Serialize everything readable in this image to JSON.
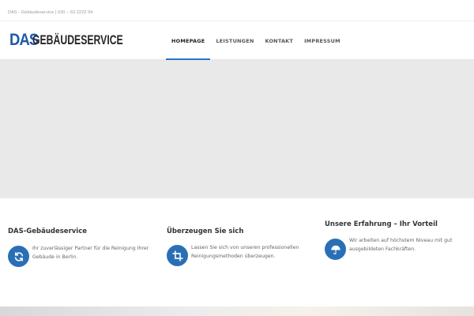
{
  "topbar": {
    "text": "DAS - Gebäudeservice | 030 – 63 2222 94"
  },
  "header": {
    "logo": {
      "part1": "DAS",
      "part2": "GEBÄUDESERVICE"
    },
    "nav": [
      {
        "label": "HOMEPAGE",
        "active": true
      },
      {
        "label": "LEISTUNGEN",
        "active": false
      },
      {
        "label": "KONTAKT",
        "active": false
      },
      {
        "label": "IMPRESSUM",
        "active": false
      }
    ]
  },
  "features": [
    {
      "title": "DAS-Gebäudeservice",
      "icon": "refresh-icon",
      "text": "Ihr zuverlässiger Partner für die Reinigung Ihrer Gebäude in Berlin."
    },
    {
      "title": "Überzeugen Sie sich",
      "icon": "crop-icon",
      "text": "Lassen Sie sich von unseren professionellen Reinigungsmethoden überzeugen."
    },
    {
      "title": "Unsere Erfahrung – Ihr Vorteil",
      "icon": "umbrella-icon",
      "text": "Wir arbeiten auf höchstem Niveau mit gut ausgebildeten Fachkräften."
    }
  ],
  "colors": {
    "accent": "#2a74c4",
    "icon_bg": "#2a6fb6",
    "logo_blue": "#1f5aa8",
    "hero_bg": "#e9e9e9"
  }
}
